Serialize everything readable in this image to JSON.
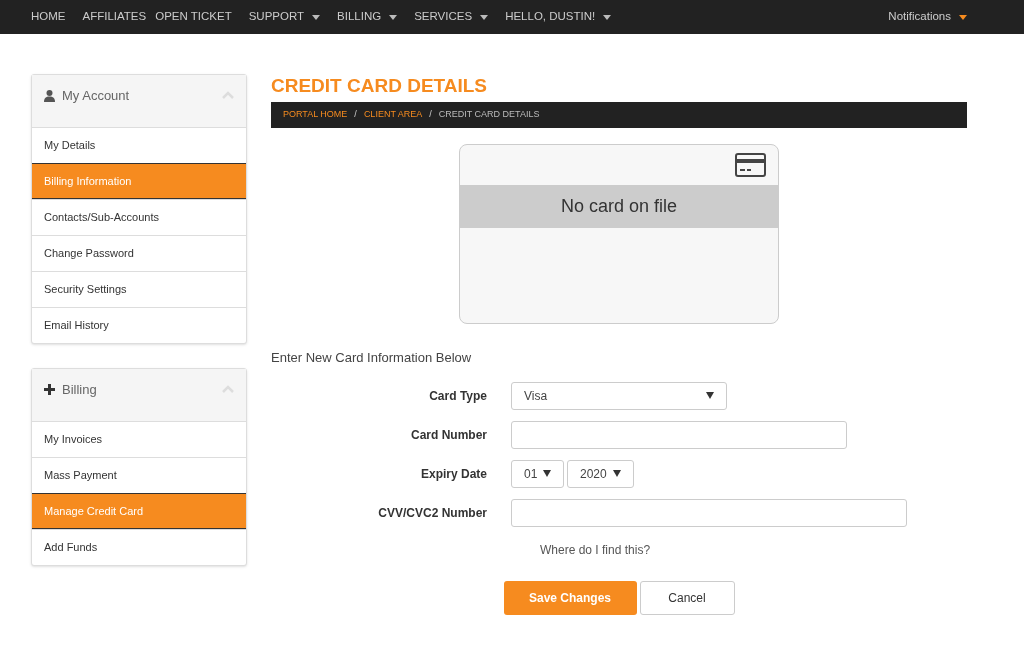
{
  "nav": {
    "items": [
      {
        "label": "HOME",
        "dropdown": false
      },
      {
        "label": "AFFILIATES",
        "dropdown": false
      },
      {
        "label": "OPEN TICKET",
        "dropdown": false
      },
      {
        "label": "SUPPORT",
        "dropdown": true
      },
      {
        "label": "BILLING",
        "dropdown": true
      },
      {
        "label": "SERVICES",
        "dropdown": true
      },
      {
        "label": "HELLO, DUSTIN!",
        "dropdown": true
      }
    ],
    "right": {
      "label": "Notifications",
      "dropdown": true
    }
  },
  "sidebar": [
    {
      "title": "My Account",
      "kind": "user",
      "expanded": true,
      "items": [
        {
          "label": "My Details",
          "selected": false
        },
        {
          "label": "Billing Information",
          "selected": true
        },
        {
          "label": "Contacts/Sub-Accounts",
          "selected": false
        },
        {
          "label": "Change Password",
          "selected": false
        },
        {
          "label": "Security Settings",
          "selected": false
        },
        {
          "label": "Email History",
          "selected": false
        }
      ]
    },
    {
      "title": "Billing",
      "kind": "plus",
      "expanded": true,
      "items": [
        {
          "label": "My Invoices",
          "selected": false
        },
        {
          "label": "Mass Payment",
          "selected": false
        },
        {
          "label": "Manage Credit Card",
          "selected": true
        },
        {
          "label": "Add Funds",
          "selected": false
        }
      ]
    }
  ],
  "page_title": "CREDIT CARD DETAILS",
  "breadcrumb": {
    "separator": "/",
    "items": [
      {
        "label": "PORTAL HOME",
        "link": true
      },
      {
        "label": "CLIENT AREA",
        "link": true
      },
      {
        "label": "CREDIT CARD DETAILS",
        "link": false
      }
    ]
  },
  "card": {
    "message": "No card on file"
  },
  "form": {
    "heading": "Enter New Card Information Below",
    "fields": [
      {
        "label": "Card Type",
        "kind": "select",
        "values": [
          "Visa"
        ]
      },
      {
        "label": "Card Number",
        "kind": "input"
      },
      {
        "label": "Expiry Date",
        "kind": "select-pair",
        "values": [
          "01",
          "2020"
        ]
      },
      {
        "label": "CVV/CVC2 Number",
        "kind": "input-wide"
      }
    ],
    "help_link": "Where do I find this?",
    "buttons": [
      {
        "label": "Save Changes",
        "kind": "primary"
      },
      {
        "label": "Cancel",
        "kind": "default"
      }
    ]
  }
}
